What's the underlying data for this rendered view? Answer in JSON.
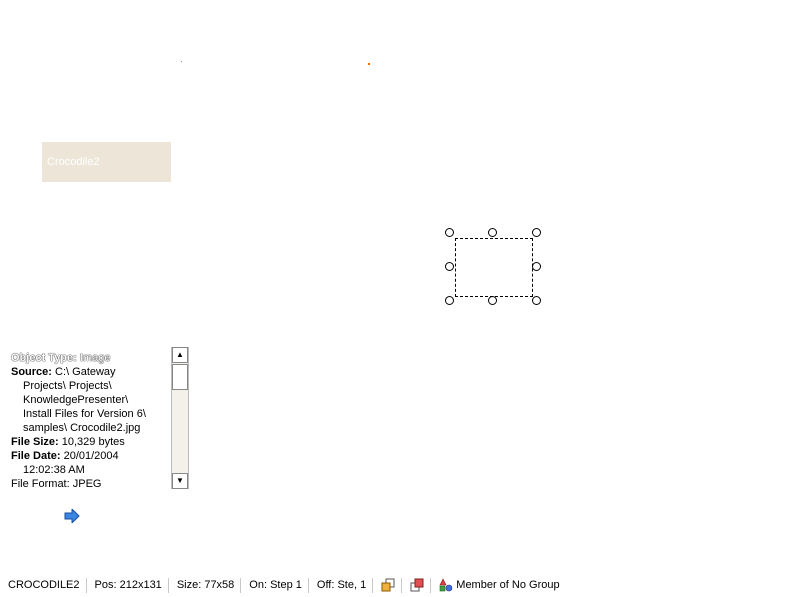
{
  "canvas": {
    "object_label": "Crocodile2",
    "accent_dot_color": "#ff6a00"
  },
  "info_panel": {
    "object_type_label": "Object Type:",
    "object_type_value": "Image",
    "source_label": "Source:",
    "source_lines": [
      "C:\\ Gateway",
      "Projects\\ Projects\\",
      "KnowledgePresenter\\",
      "Install Files for Version 6\\",
      "samples\\ Crocodile2.jpg"
    ],
    "file_size_label": "File Size:",
    "file_size_value": "10,329 bytes",
    "file_date_label": "File Date:",
    "file_date_value": "20/01/2004",
    "file_time_value": "12:02:38 AM",
    "cut_off_line": "File Format: JPEG"
  },
  "status_bar": {
    "object_name": "CROCODILE2",
    "position": "Pos: 212x131",
    "size": "Size: 77x58",
    "on_step": "On: Step 1",
    "off_step": "Off: Ste, 1",
    "group": "Member of No Group"
  }
}
